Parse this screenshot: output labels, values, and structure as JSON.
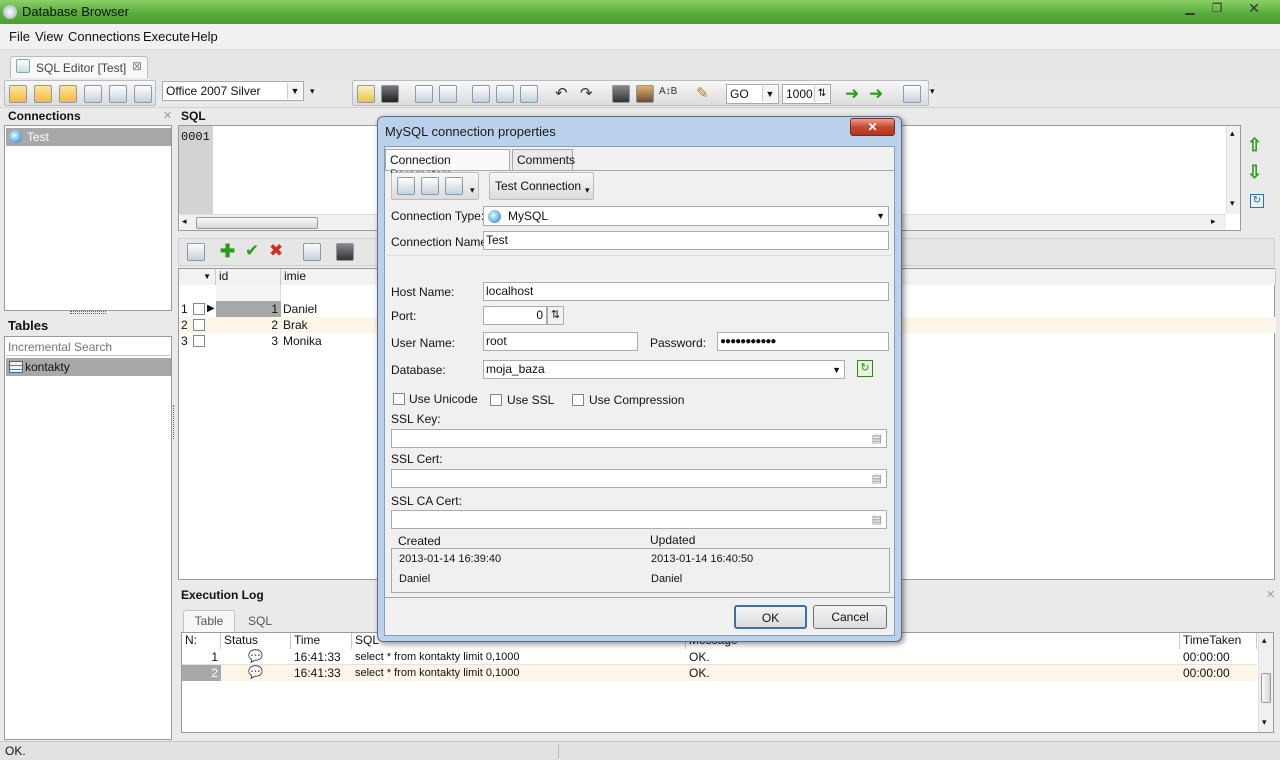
{
  "window": {
    "title": "Database Browser"
  },
  "menu": [
    "File",
    "View",
    "Connections",
    "Execute",
    "Help"
  ],
  "doc_tab": {
    "label": "SQL Editor [Test]"
  },
  "toolbar": {
    "theme": "Office 2007 Silver",
    "go_mode": "GO",
    "limit": "1000"
  },
  "connections": {
    "header": "Connections",
    "items": [
      "Test"
    ]
  },
  "tables": {
    "header": "Tables",
    "search_placeholder": "Incremental Search",
    "items": [
      "kontakty"
    ]
  },
  "sql": {
    "header": "SQL",
    "line_number": "0001"
  },
  "grid": {
    "columns": [
      "id",
      "imie"
    ],
    "rows": [
      {
        "n": "1",
        "id": "1",
        "imie": "Daniel"
      },
      {
        "n": "2",
        "id": "2",
        "imie": "Brak"
      },
      {
        "n": "3",
        "id": "3",
        "imie": "Monika"
      }
    ]
  },
  "log": {
    "header": "Execution Log",
    "tabs": [
      "Table",
      "SQL"
    ],
    "columns": [
      "N:",
      "Status",
      "Time",
      "SQL",
      "Message",
      "TimeTaken"
    ],
    "rows": [
      {
        "n": "1",
        "time": "16:41:33",
        "sql": "select * from kontakty limit 0,1000",
        "message": "OK.",
        "taken": "00:00:00"
      },
      {
        "n": "2",
        "time": "16:41:33",
        "sql": "select * from kontakty limit 0,1000",
        "message": "OK.",
        "taken": "00:00:00"
      }
    ]
  },
  "status": {
    "text": "OK."
  },
  "dialog": {
    "title": "MySQL connection properties",
    "tabs": [
      "Connection Parameters",
      "Comments"
    ],
    "test_button": "Test Connection",
    "connection_type_label": "Connection Type:",
    "connection_type": "MySQL",
    "connection_name_label": "Connection Name:",
    "connection_name": "Test",
    "host_label": "Host Name:",
    "host": "localhost",
    "port_label": "Port:",
    "port": "0",
    "user_label": "User Name:",
    "user": "root",
    "password_label": "Password:",
    "password": "●●●●●●●●●●●",
    "database_label": "Database:",
    "database": "moja_baza",
    "use_unicode": "Use Unicode",
    "use_ssl": "Use SSL",
    "use_compression": "Use Compression",
    "ssl_key_label": "SSL Key:",
    "ssl_cert_label": "SSL Cert:",
    "ssl_ca_label": "SSL CA Cert:",
    "created_label": "Created",
    "updated_label": "Updated",
    "created": "2013-01-14 16:39:40",
    "updated": "2013-01-14 16:40:50",
    "created_by": "Daniel",
    "updated_by": "Daniel",
    "ok": "OK",
    "cancel": "Cancel"
  }
}
